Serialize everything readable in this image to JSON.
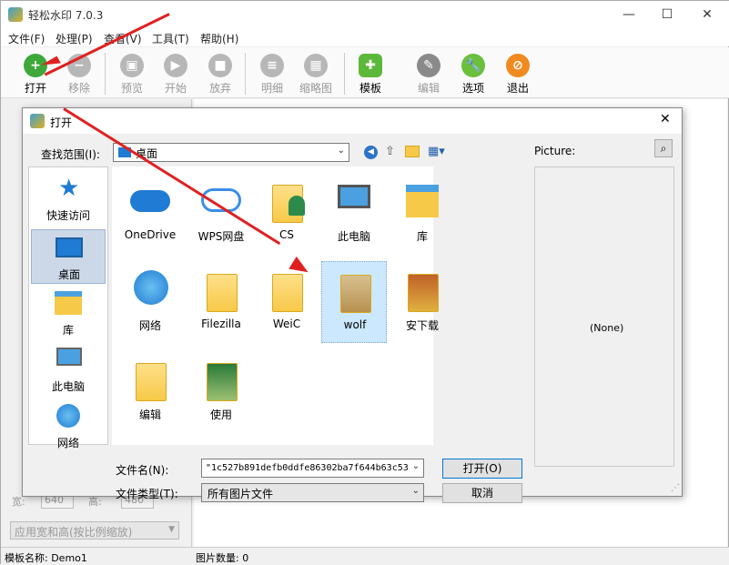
{
  "app": {
    "title": "轻松水印 7.0.3"
  },
  "menu": [
    "文件(F)",
    "处理(P)",
    "查看(V)",
    "工具(T)",
    "帮助(H)"
  ],
  "toolbar": {
    "open": "打开",
    "remove": "移除",
    "preview": "预览",
    "start": "开始",
    "abort": "放弃",
    "detail": "明细",
    "thumbnail": "缩略图",
    "template": "模板",
    "edit": "编辑",
    "options": "选项",
    "exit": "退出"
  },
  "left_panel": {
    "size_w_label": "宽:",
    "size_w": "640",
    "size_h_label": "高:",
    "size_h": "480",
    "resize_mode": "应用宽和高(按比例缩放)"
  },
  "status": {
    "template_name": "模板名称: Demo1",
    "image_count": "图片数量: 0"
  },
  "dialog": {
    "title": "打开",
    "look_in_label": "查找范围(I):",
    "look_in_value": "桌面",
    "places": [
      "快速访问",
      "桌面",
      "库",
      "此电脑",
      "网络"
    ],
    "files": [
      "OneDrive",
      "WPS网盘",
      "CS",
      "此电脑",
      "库",
      "网络",
      "Filezilla",
      "WeiC",
      "wolf",
      "安下载",
      "编辑",
      "使用"
    ],
    "filename_label": "文件名(N):",
    "filename_value": "\"1c527b891defb0ddfe86302ba7f644b63c53",
    "filetype_label": "文件类型(T):",
    "filetype_value": "所有图片文件",
    "open_button": "打开(O)",
    "cancel_button": "取消",
    "picture_label": "Picture:",
    "picture_none": "(None)"
  },
  "colors": {
    "open_green": "#3ea83a",
    "accent_red": "#e02020",
    "selection": "#cce8ff"
  }
}
